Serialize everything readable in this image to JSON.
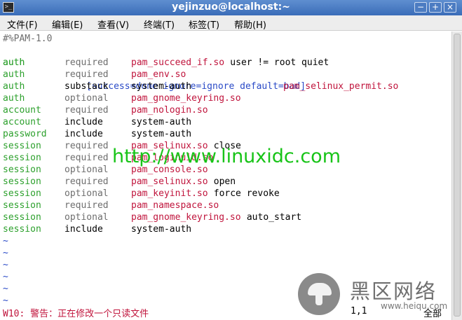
{
  "window": {
    "title": "yejinzuo@localhost:~",
    "app_icon_glyph": ">_",
    "controls": {
      "minimize": "−",
      "maximize": "+",
      "close": "×"
    }
  },
  "menubar": {
    "items": [
      "文件(F)",
      "编辑(E)",
      "查看(V)",
      "终端(T)",
      "标签(T)",
      "帮助(H)"
    ]
  },
  "terminal": {
    "header_line": "#%PAM-1.0",
    "first_rule": {
      "type": "auth",
      "control_open": "[",
      "control_items": [
        "success=done",
        "ignore=ignore",
        "default=bad"
      ],
      "control_close": "]",
      "module": "pam_selinux_permit.so"
    },
    "rules": [
      {
        "type": "auth",
        "control": "required",
        "module": "pam_succeed_if.so",
        "args": "user != root quiet"
      },
      {
        "type": "auth",
        "control": "required",
        "module": "pam_env.so",
        "args": ""
      },
      {
        "type": "auth",
        "control": "substack",
        "module": "system-auth",
        "args": ""
      },
      {
        "type": "auth",
        "control": "optional",
        "module": "pam_gnome_keyring.so",
        "args": ""
      },
      {
        "type": "account",
        "control": "required",
        "module": "pam_nologin.so",
        "args": ""
      },
      {
        "type": "account",
        "control": "include",
        "module": "system-auth",
        "args": ""
      },
      {
        "type": "password",
        "control": "include",
        "module": "system-auth",
        "args": ""
      },
      {
        "type": "session",
        "control": "required",
        "module": "pam_selinux.so",
        "args": "close"
      },
      {
        "type": "session",
        "control": "required",
        "module": "pam_loginuid.so",
        "args": ""
      },
      {
        "type": "session",
        "control": "optional",
        "module": "pam_console.so",
        "args": ""
      },
      {
        "type": "session",
        "control": "required",
        "module": "pam_selinux.so",
        "args": "open"
      },
      {
        "type": "session",
        "control": "optional",
        "module": "pam_keyinit.so",
        "args": "force revoke"
      },
      {
        "type": "session",
        "control": "required",
        "module": "pam_namespace.so",
        "args": ""
      },
      {
        "type": "session",
        "control": "optional",
        "module": "pam_gnome_keyring.so",
        "args": "auto_start"
      },
      {
        "type": "session",
        "control": "include",
        "module": "system-auth",
        "args": ""
      }
    ],
    "empty_line_marker": "~",
    "empty_line_count": 6,
    "status_warning": "W10: 警告：正在修改一个只读文件",
    "status_position": "1,1",
    "status_percent": "全部"
  },
  "watermark": {
    "text": "http://www.linuxidc.com"
  },
  "logo": {
    "name": "黑区网络",
    "url": "www.heiqu.com"
  },
  "colors": {
    "titlebar": "#3a6cb8",
    "type_keyword": "#2ca02c",
    "control_keyword": "#6e6e6e",
    "module_pam": "#c0143c",
    "bracket_args": "#2a4ac7",
    "watermark": "#18c418",
    "warning": "#c0143c"
  }
}
